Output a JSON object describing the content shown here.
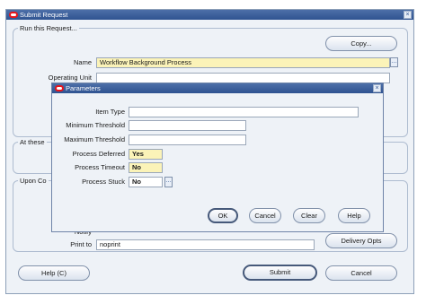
{
  "main": {
    "title": "Submit Request",
    "run_group": "Run this Request...",
    "copy_button": "Copy...",
    "name_label": "Name",
    "name_value": "Workflow Background Process",
    "operating_unit_label": "Operating Unit",
    "at_these_label": "At these",
    "upon_completion_label": "Upon Co",
    "notify_label": "Notify",
    "print_to_label": "Print to",
    "print_to_value": "noprint",
    "delivery_opts_button": "Delivery Opts",
    "help_button": "Help (C)",
    "submit_button": "Submit",
    "cancel_button": "Cancel"
  },
  "params": {
    "title": "Parameters",
    "item_type_label": "Item Type",
    "item_type_value": "",
    "min_threshold_label": "Minimum Threshold",
    "min_threshold_value": "",
    "max_threshold_label": "Maximum Threshold",
    "max_threshold_value": "",
    "deferred_label": "Process Deferred",
    "deferred_value": "Yes",
    "timeout_label": "Process Timeout",
    "timeout_value": "No",
    "stuck_label": "Process Stuck",
    "stuck_value": "No",
    "ok_button": "OK",
    "cancel_button": "Cancel",
    "clear_button": "Clear",
    "help_button": "Help"
  }
}
